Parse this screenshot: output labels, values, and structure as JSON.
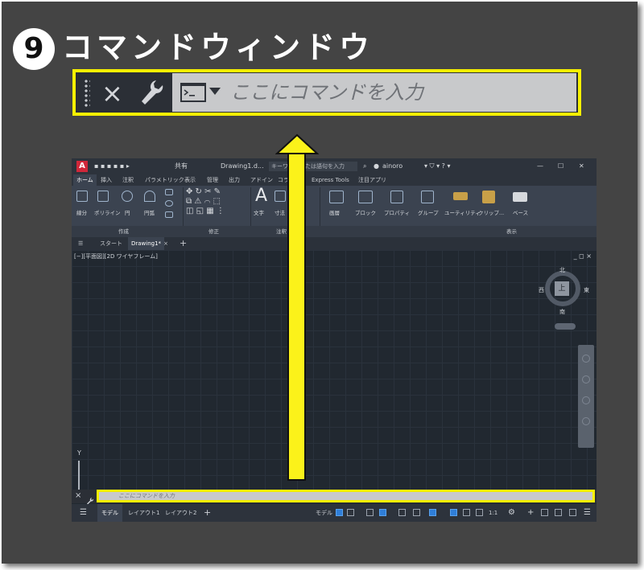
{
  "heading": {
    "step": "9",
    "title": "コマンドウィンドウ"
  },
  "command_line": {
    "close": "×",
    "placeholder": "ここにコマンドを入力"
  },
  "app": {
    "titlebar": {
      "logo": "A",
      "share": "共有",
      "document": "Drawing1.d...",
      "search_hint": "キーワードまたは語句を入力",
      "user": "ainoro"
    },
    "ribbon_tabs": [
      "ホーム",
      "挿入",
      "注釈",
      "パラメトリック",
      "表示",
      "管理",
      "出力",
      "アドイン",
      "コラボ",
      "Express Tools",
      "注目アプリ"
    ],
    "draw_tools": [
      "線分",
      "ポリライン",
      "円",
      "円弧"
    ],
    "annotation_tools": [
      "文字",
      "寸法"
    ],
    "large_tools": [
      "画層",
      "ブロック",
      "プロパティ",
      "グループ",
      "ユーティリティ",
      "クリップ..."
    ],
    "panels": {
      "draw": "作成",
      "modify": "修正",
      "annotation": "注釈",
      "view": "表示"
    },
    "base_tool": "ベース",
    "file_tabs": {
      "start": "スタート",
      "drawing": "Drawing1*"
    },
    "viewport": {
      "label": "[−][平面図][2D ワイヤフレーム]",
      "controls": "_ ◻ ×",
      "viewcube": {
        "top": "上",
        "north": "北",
        "south": "南",
        "east": "東",
        "west": "西"
      },
      "ucs_axis": "Y"
    },
    "command_placeholder_small": "ここにコマンドを入力",
    "layout_tabs": [
      "モデル",
      "レイアウト1",
      "レイアウト2"
    ],
    "status": {
      "model": "モデル",
      "scale": "1:1"
    }
  },
  "colors": {
    "highlight": "#f6f000",
    "arrow": "#fbf21a",
    "frame": "#444444",
    "app_bg": "#212830"
  }
}
